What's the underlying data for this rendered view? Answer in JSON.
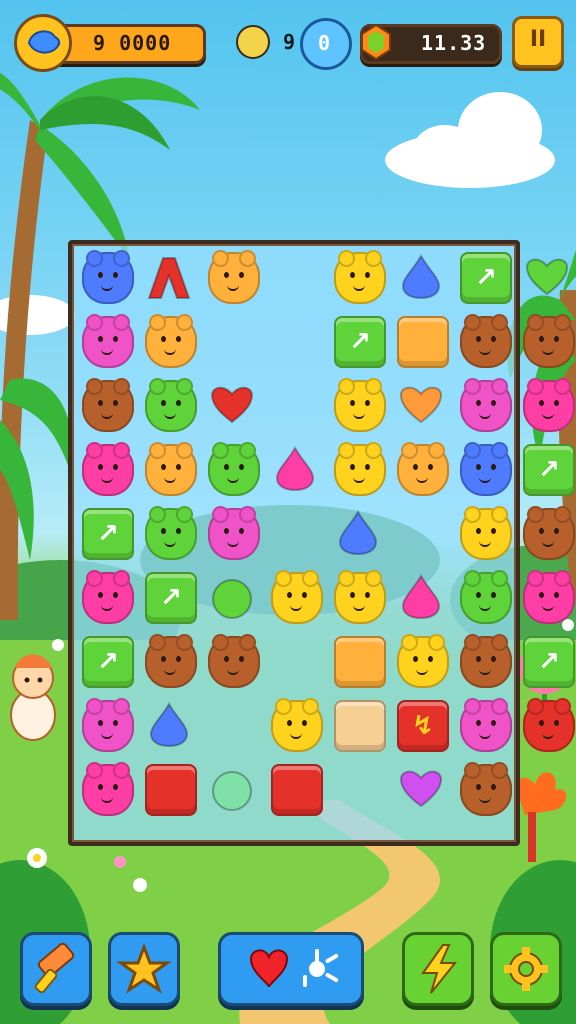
{
  "hud": {
    "score": "9 0000",
    "moves_count": "9",
    "moves_target": "0",
    "gems": "11.33",
    "pause_label": "II"
  },
  "colors": {
    "pink": "#f052c8",
    "orange": "#ffb13b",
    "brown": "#b8602c",
    "yellow": "#ffd21e",
    "green": "#5fd33a",
    "blue": "#4f7bff",
    "red": "#e4312a",
    "magenta": "#ff3ea5",
    "cream": "#f6cf94"
  },
  "board": {
    "rows": [
      [
        "blue-bear",
        "red-peak",
        "orange-bear",
        "empty",
        "yellow-bear",
        "blue-drop",
        "green-block",
        "green-heart"
      ],
      [
        "pink-bear",
        "orange-bear",
        "empty",
        "empty",
        "green-block",
        "orange-block",
        "brown-bear",
        "brown-bear"
      ],
      [
        "brown-bear",
        "green-bear",
        "red-heart",
        "empty",
        "yellow-bear",
        "rainbow-heart",
        "pink-bear",
        "magenta-bear"
      ],
      [
        "magenta-bear",
        "orange-bear",
        "green-bear",
        "magenta-drop",
        "yellow-bear",
        "orange-bear",
        "blue-bear",
        "green-block"
      ],
      [
        "green-block",
        "green-bear",
        "pink-bear",
        "empty",
        "blue-drop",
        "empty",
        "yellow-bear",
        "brown-bear"
      ],
      [
        "magenta-bear",
        "green-block",
        "green-apple",
        "yellow-bear",
        "yellow-bear",
        "magenta-drop",
        "green-bear",
        "magenta-bear"
      ],
      [
        "green-block",
        "brown-bear",
        "brown-bear",
        "empty",
        "orange-block",
        "yellow-bear",
        "brown-bear",
        "green-block"
      ],
      [
        "pink-bear",
        "blue-drop",
        "empty",
        "yellow-bear",
        "cream-block",
        "red-bolt-block",
        "pink-bear",
        "red-bear"
      ],
      [
        "magenta-bear",
        "red-block",
        "mint-apple",
        "red-block",
        "empty",
        "purple-heart",
        "brown-bear",
        "empty"
      ]
    ]
  },
  "toolbar": {
    "buttons": [
      "hammer-icon",
      "star-icon",
      "heart-icon",
      "splash-icon",
      "bolt-icon",
      "gear-icon"
    ]
  }
}
